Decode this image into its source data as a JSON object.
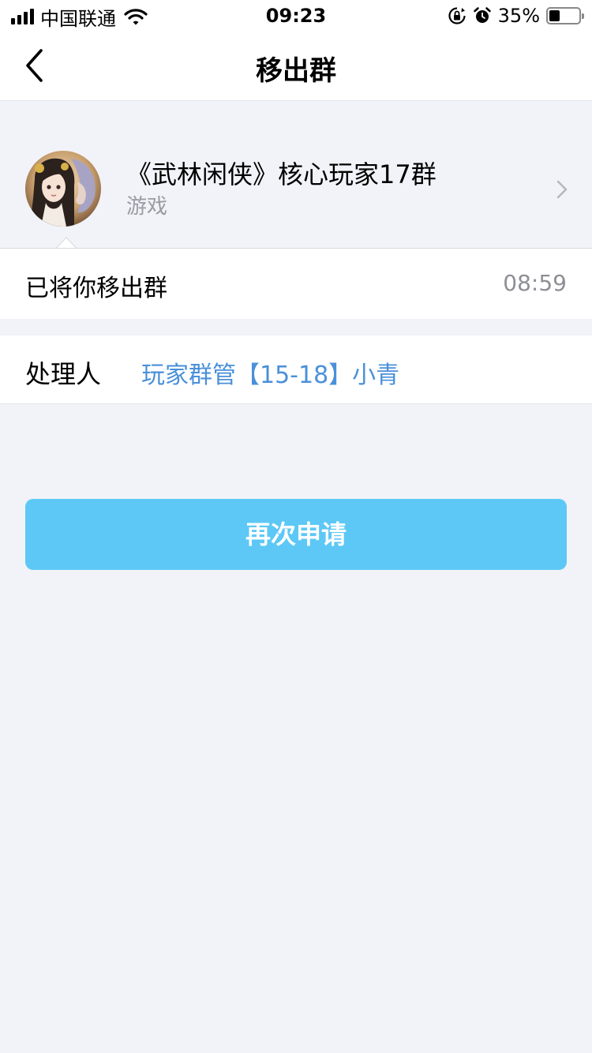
{
  "status_bar": {
    "carrier": "中国联通",
    "time": "09:23",
    "battery_percent": "35%",
    "battery_level": 0.35,
    "icons": [
      "signal-icon",
      "wifi-icon",
      "orientation-lock-icon",
      "alarm-icon",
      "battery-icon"
    ]
  },
  "nav": {
    "title": "移出群",
    "back_icon": "chevron-left-icon"
  },
  "group": {
    "name": "《武林闲侠》核心玩家17群",
    "category": "游戏",
    "avatar": "group-avatar",
    "chevron_icon": "chevron-right-icon"
  },
  "message": {
    "text": "已将你移出群",
    "time": "08:59"
  },
  "handler": {
    "label": "处理人",
    "name": "玩家群管【15-18】小青"
  },
  "actions": {
    "reapply_label": "再次申请"
  },
  "colors": {
    "background": "#f2f3f8",
    "accent_button": "#5dc8f6",
    "link": "#4a90d9",
    "secondary_text": "#9a9ba3"
  }
}
